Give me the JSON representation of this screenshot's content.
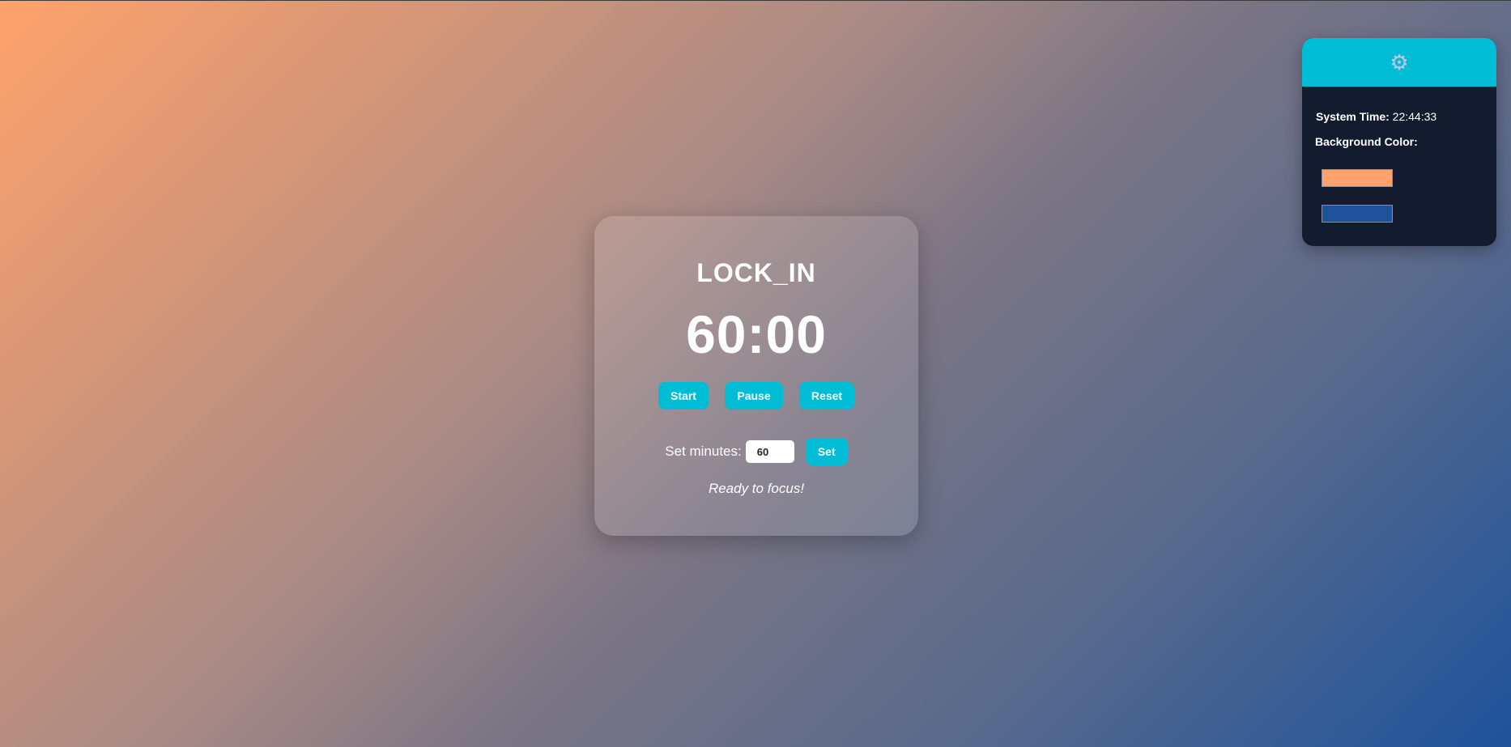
{
  "timer": {
    "title": "LOCK_IN",
    "display": "60:00",
    "buttons": {
      "start": "Start",
      "pause": "Pause",
      "reset": "Reset"
    },
    "set_minutes": {
      "label": "Set minutes:",
      "value": "60",
      "button": "Set"
    },
    "status": "Ready to focus!"
  },
  "settings": {
    "icon": "gear-icon",
    "system_time_label": "System Time:",
    "system_time_value": "22:44:33",
    "background_color_label": "Background Color:",
    "colors": [
      "#ffa26b",
      "#1e539b"
    ]
  },
  "theme": {
    "accent": "#00bcd4",
    "panel_bg": "#131c2e",
    "text": "#ffffff"
  }
}
